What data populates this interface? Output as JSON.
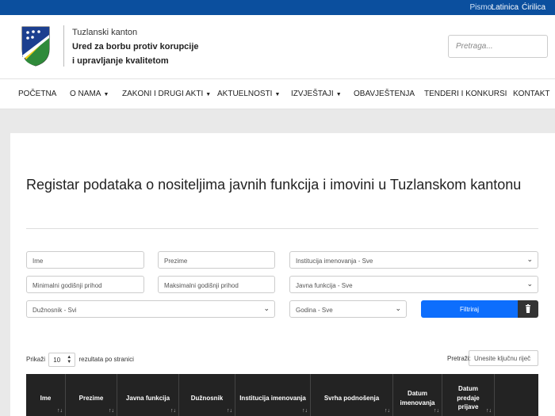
{
  "topbar": {
    "pismo_label": "Pismo:",
    "latinica": "Latinica",
    "cirilica": "Ćirilica"
  },
  "header": {
    "org_line1": "Tuzlanski kanton",
    "org_line2": "Ured za borbu protiv korupcije",
    "org_line3": "i upravljanje kvalitetom",
    "search_placeholder": "Pretraga..."
  },
  "nav": {
    "items": [
      {
        "label": "POČETNA"
      },
      {
        "label": "O NAMA"
      },
      {
        "label": "ZAKONI I DRUGI AKTI"
      },
      {
        "label": "AKTUELNOSTI"
      },
      {
        "label": "IZVJEŠTAJI"
      },
      {
        "label": "OBAVJEŠTENJA"
      },
      {
        "label": "TENDERI I KONKURSI"
      },
      {
        "label": "KONTAKT"
      }
    ]
  },
  "main": {
    "title": "Registar podataka o nositeljima javnih funkcija i imovini u Tuzlanskom kantonu",
    "filters": {
      "ime": "Ime",
      "prezime": "Prezime",
      "institucija": "Institucija imenovanja - Sve",
      "min_prihod": "Minimalni godišnji prihod",
      "max_prihod": "Maksimalni godišnji prihod",
      "javna_funkcija": "Javna funkcija - Sve",
      "duznosnik": "Dužnosnik - Svi",
      "godina": "Godina - Sve",
      "filter_button": "Filtriraj"
    },
    "table_controls": {
      "show_label": "Prikaži",
      "page_size": "10",
      "per_page_label": "rezultata po stranici",
      "search_label": "Pretraži:",
      "search_placeholder": "Unesite ključnu riječ"
    },
    "columns": [
      {
        "l1": "Ime",
        "l2": ""
      },
      {
        "l1": "Prezime",
        "l2": ""
      },
      {
        "l1": "Javna funkcija",
        "l2": ""
      },
      {
        "l1": "Dužnosnik",
        "l2": ""
      },
      {
        "l1": "Institucija imenovanja",
        "l2": ""
      },
      {
        "l1": "Svrha podnošenja",
        "l2": ""
      },
      {
        "l1": "Datum",
        "l2": "imenovanja"
      },
      {
        "l1": "Datum",
        "l2": "predaje prijave"
      }
    ]
  },
  "colors": {
    "topbar": "#0b4f9e",
    "primary_button": "#0d6efd",
    "table_header": "#232323"
  },
  "icons": {
    "nav_dropdown": "chevron-down-icon",
    "select_arrow": "chevron-down-icon",
    "delete": "trash-icon",
    "sort": "sort-icon"
  }
}
